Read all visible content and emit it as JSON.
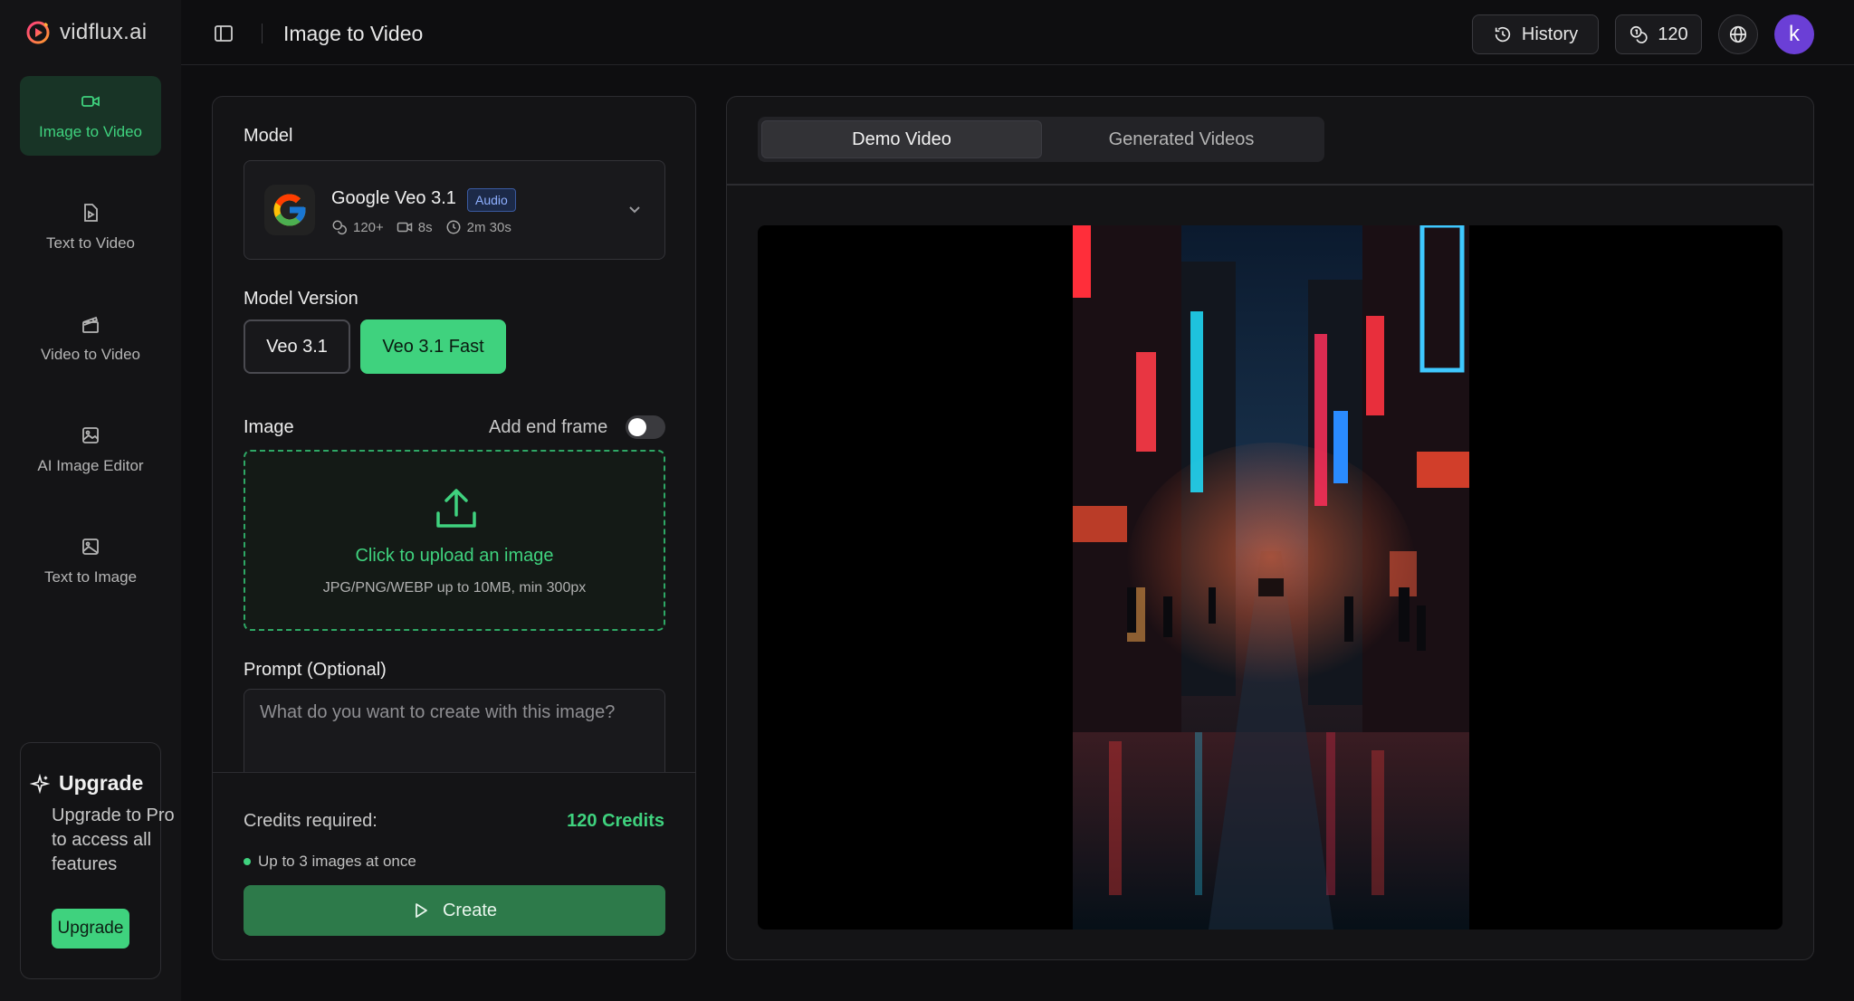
{
  "brand": {
    "name": "vidflux.ai"
  },
  "sidebar": {
    "items": [
      {
        "label": "Image to Video",
        "icon": "video-camera-icon",
        "active": true
      },
      {
        "label": "Text to Video",
        "icon": "document-video-icon",
        "active": false
      },
      {
        "label": "Video to Video",
        "icon": "clapperboard-icon",
        "active": false
      },
      {
        "label": "AI Image Editor",
        "icon": "image-edit-icon",
        "active": false
      },
      {
        "label": "Text to Image",
        "icon": "image-icon",
        "active": false
      }
    ],
    "upgrade": {
      "title": "Upgrade",
      "description": "Upgrade to Pro to access all features",
      "button_label": "Upgrade"
    }
  },
  "header": {
    "page_title": "Image to Video",
    "history_label": "History",
    "credits": "120",
    "avatar_initial": "k"
  },
  "form": {
    "model_label": "Model",
    "model": {
      "name": "Google Veo 3.1",
      "badge": "Audio",
      "credits": "120+",
      "duration": "8s",
      "gen_time": "2m 30s"
    },
    "version_label": "Model Version",
    "versions": [
      {
        "label": "Veo 3.1",
        "selected": false
      },
      {
        "label": "Veo 3.1 Fast",
        "selected": true
      }
    ],
    "image_label": "Image",
    "end_frame_label": "Add end frame",
    "end_frame_enabled": false,
    "upload_title": "Click to upload an image",
    "upload_hint": "JPG/PNG/WEBP up to 10MB, min 300px",
    "prompt_label": "Prompt (Optional)",
    "prompt_placeholder": "What do you want to create with this image?",
    "credits_label": "Credits required:",
    "credits_value": "120 Credits",
    "info": "Up to 3 images at once",
    "create_label": "Create"
  },
  "preview": {
    "tabs": [
      {
        "label": "Demo Video",
        "active": true
      },
      {
        "label": "Generated Videos",
        "active": false
      }
    ]
  },
  "colors": {
    "accent": "#3fd27e",
    "accent_dark": "#2d7a4a",
    "background": "#0e0e10",
    "panel": "#141416",
    "avatar": "#6b3fd6",
    "badge": "#8fb0ff"
  }
}
